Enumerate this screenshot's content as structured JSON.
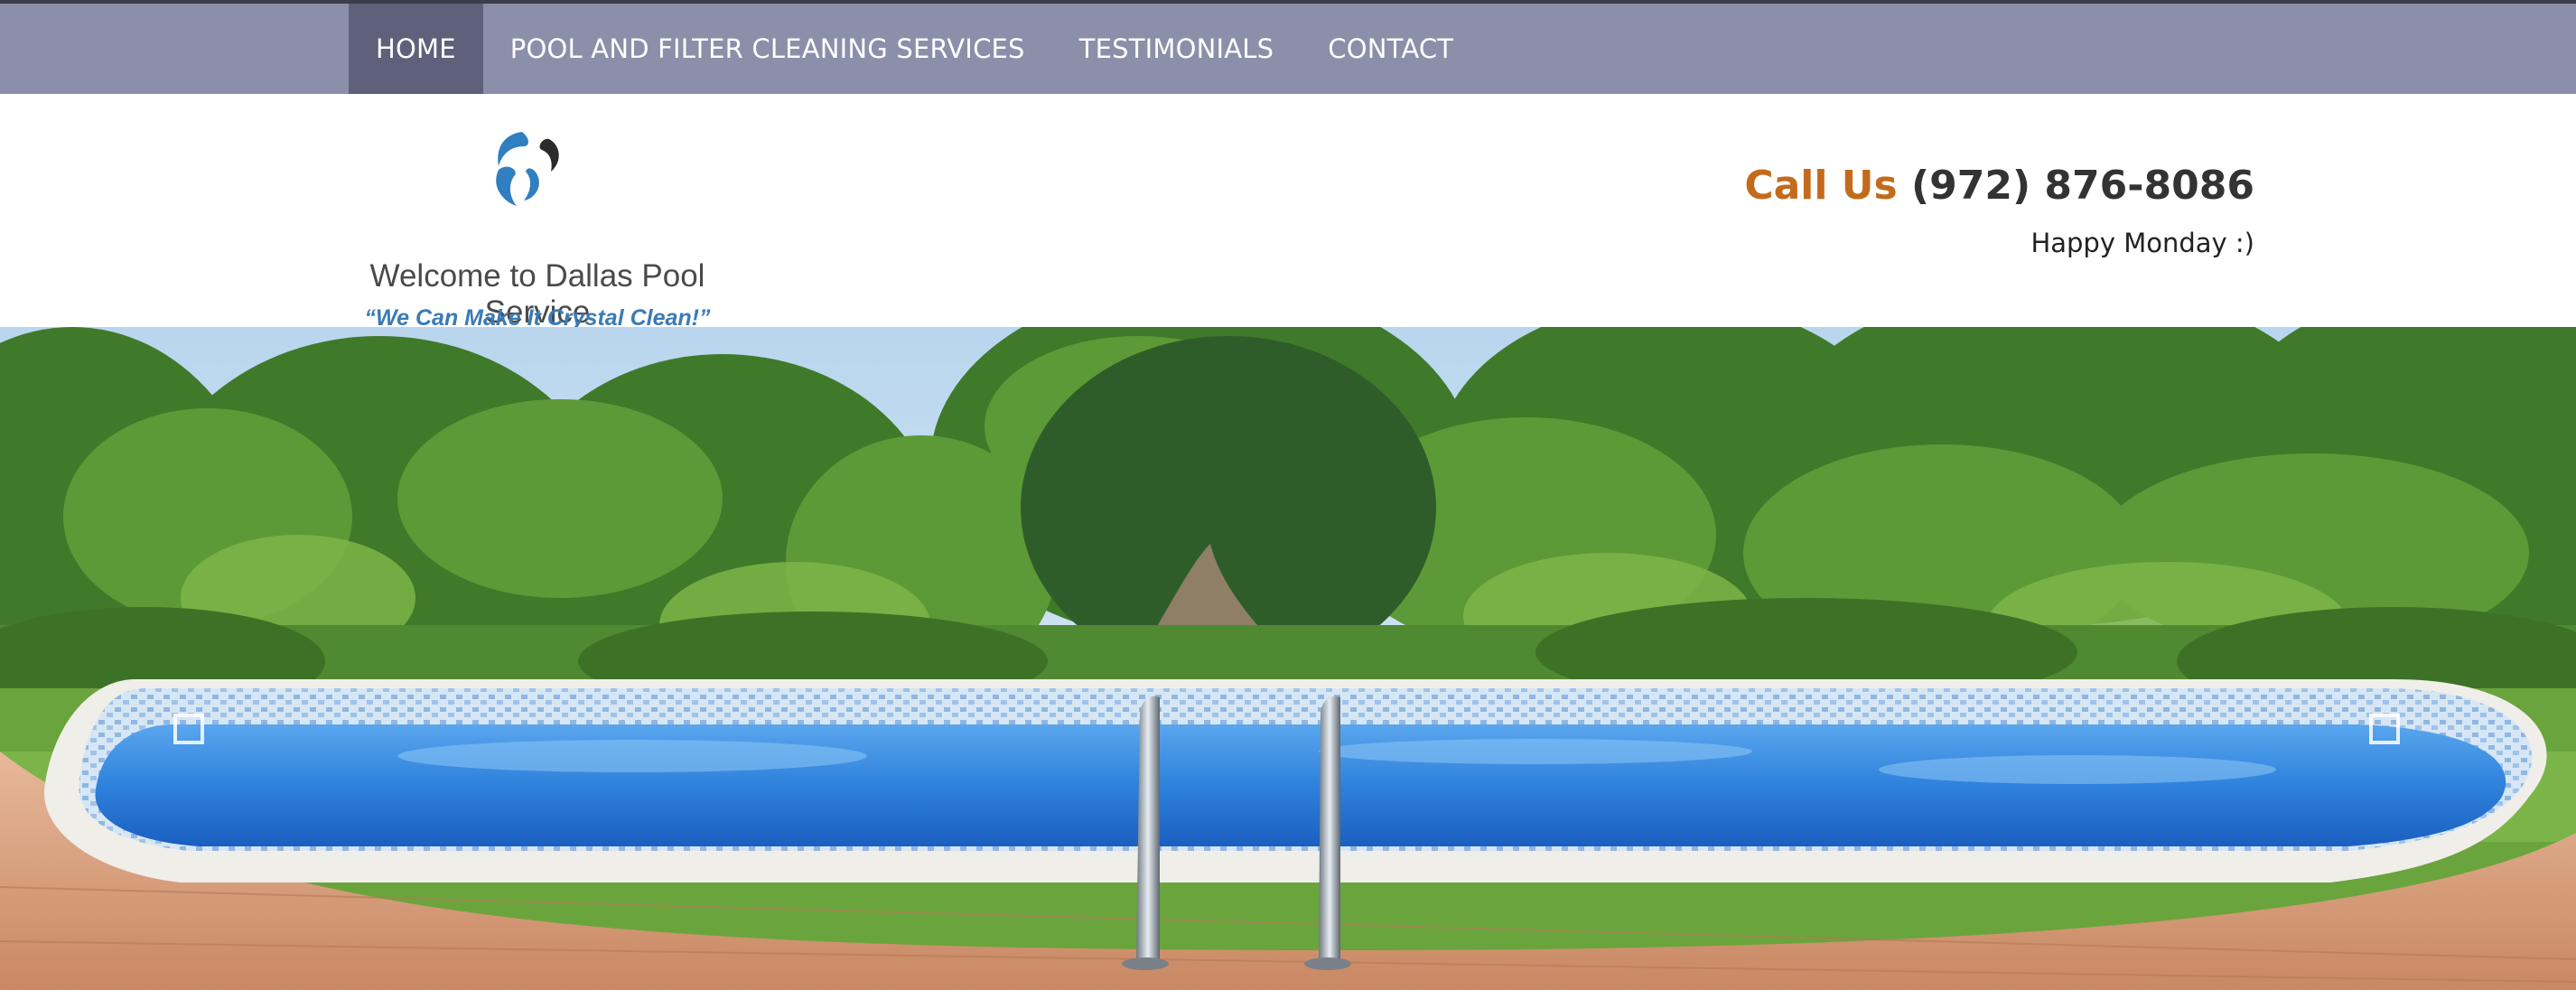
{
  "nav": {
    "items": [
      {
        "label": "HOME",
        "active": true
      },
      {
        "label": "POOL AND FILTER CLEANING SERVICES",
        "active": false
      },
      {
        "label": "TESTIMONIALS",
        "active": false
      },
      {
        "label": "CONTACT",
        "active": false
      }
    ]
  },
  "header": {
    "logo_icon": "swirl-logo-icon",
    "brand_name": "Welcome to Dallas Pool Service",
    "slogan": "“We Can Make It Crystal Clean!”",
    "call_label": "Call Us",
    "phone": "(972) 876-8086",
    "greeting": "Happy Monday :)"
  },
  "hero": {
    "image": "pool-photo",
    "prev_icon": "slider-prev-icon",
    "next_icon": "slider-next-icon"
  },
  "colors": {
    "nav_bg": "#8b8fa9",
    "nav_active": "#5e6179",
    "call_accent": "#c36a1c",
    "slogan_blue": "#3a7bb5"
  }
}
